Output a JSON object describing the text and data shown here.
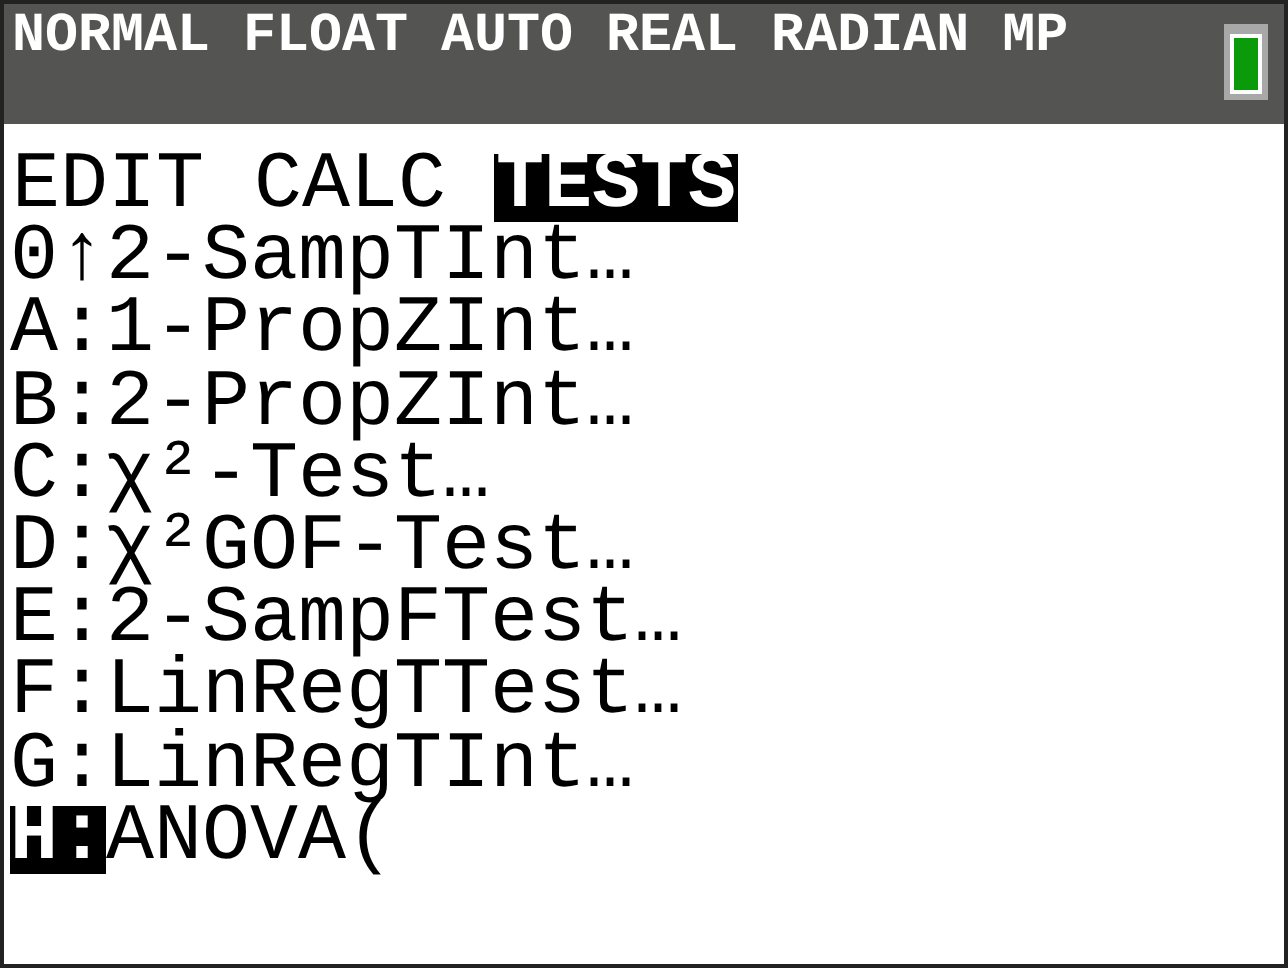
{
  "status_bar": {
    "text": "NORMAL FLOAT AUTO REAL RADIAN MP"
  },
  "tabs": [
    {
      "label": "EDIT",
      "selected": false
    },
    {
      "label": "CALC",
      "selected": false
    },
    {
      "label": "TESTS",
      "selected": true
    }
  ],
  "items": [
    {
      "key": "0↑",
      "label": "2-SampTInt…",
      "selected": false
    },
    {
      "key": "A:",
      "label": "1-PropZInt…",
      "selected": false
    },
    {
      "key": "B:",
      "label": "2-PropZInt…",
      "selected": false
    },
    {
      "key": "C:",
      "label": "χ²-Test…",
      "selected": false
    },
    {
      "key": "D:",
      "label": "χ²GOF-Test…",
      "selected": false
    },
    {
      "key": "E:",
      "label": "2-SampFTest…",
      "selected": false
    },
    {
      "key": "F:",
      "label": "LinRegTTest…",
      "selected": false
    },
    {
      "key": "G:",
      "label": "LinRegTInt…",
      "selected": false
    },
    {
      "key": "H:",
      "label": "ANOVA(",
      "selected": true
    }
  ]
}
